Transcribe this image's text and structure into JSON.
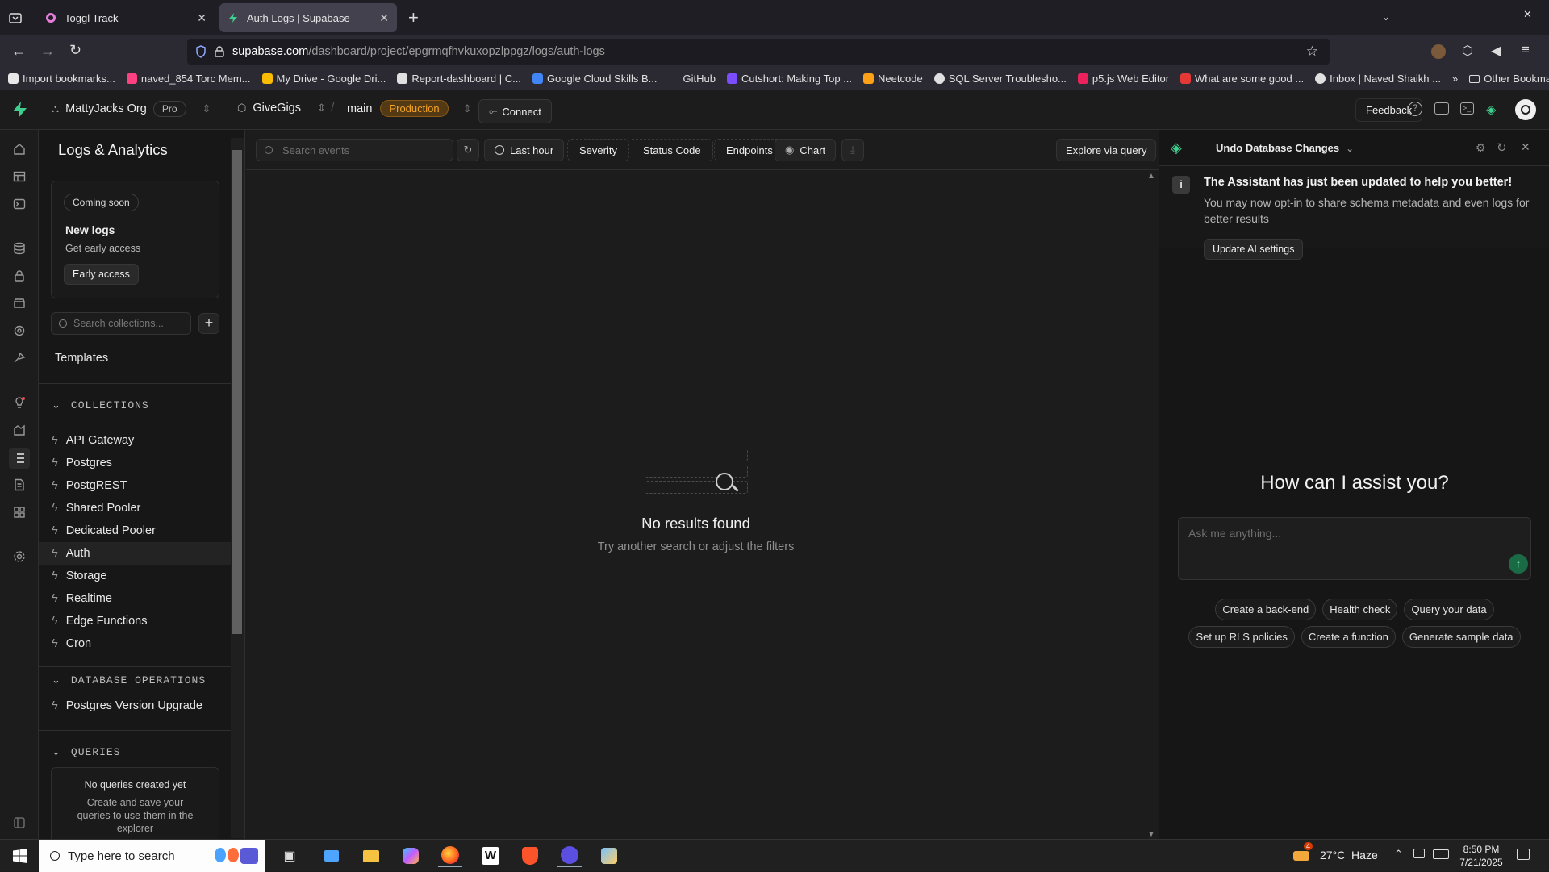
{
  "browser": {
    "tabs": [
      {
        "title": "Toggl Track",
        "active": false
      },
      {
        "title": "Auth Logs | Supabase",
        "active": true
      }
    ],
    "url": {
      "host": "supabase.com",
      "path": "/dashboard/project/epgrmqfhvkuxopzlppgz/logs/auth-logs"
    },
    "bookmarks": [
      {
        "label": "Import bookmarks...",
        "color": "#e8e8e8"
      },
      {
        "label": "naved_854 Torc Mem...",
        "color": "#ff4081"
      },
      {
        "label": "My Drive - Google Dri...",
        "color": "#fbbc04"
      },
      {
        "label": "Report-dashboard | C...",
        "color": "#e0e0e0"
      },
      {
        "label": "Google Cloud Skills B...",
        "color": "#4285f4"
      },
      {
        "label": "GitHub",
        "color": "#2b2a33"
      },
      {
        "label": "Cutshort: Making Top ...",
        "color": "#7c4dff"
      },
      {
        "label": "Neetcode",
        "color": "#ffa116"
      },
      {
        "label": "SQL Server Troublesho...",
        "color": "#e0e0e0"
      },
      {
        "label": "p5.js Web Editor",
        "color": "#ed225d"
      },
      {
        "label": "What are some good ...",
        "color": "#e53935"
      },
      {
        "label": "Inbox | Naved Shaikh ...",
        "color": "#e0e0e0"
      }
    ],
    "other_bookmarks": "Other Bookmarks"
  },
  "header": {
    "org": "MattyJacks Org",
    "plan": "Pro",
    "project": "GiveGigs",
    "branch": "main",
    "environment": "Production",
    "connect": "Connect",
    "feedback": "Feedback"
  },
  "sidebar": {
    "title": "Logs & Analytics",
    "promo": {
      "badge": "Coming soon",
      "title": "New logs",
      "subtitle": "Get early access",
      "button": "Early access"
    },
    "search_placeholder": "Search collections...",
    "templates": "Templates",
    "collections_header": "COLLECTIONS",
    "collections": [
      "API Gateway",
      "Postgres",
      "PostgREST",
      "Shared Pooler",
      "Dedicated Pooler",
      "Auth",
      "Storage",
      "Realtime",
      "Edge Functions",
      "Cron"
    ],
    "selected": "Auth",
    "db_ops_header": "DATABASE OPERATIONS",
    "db_ops": [
      "Postgres Version Upgrade"
    ],
    "queries_header": "QUERIES",
    "queries_empty_title": "No queries created yet",
    "queries_empty_text": "Create and save your queries to use them in the explorer"
  },
  "toolbar": {
    "search_placeholder": "Search events",
    "time_range": "Last hour",
    "severity": "Severity",
    "status_code": "Status Code",
    "endpoints": "Endpoints",
    "chart": "Chart",
    "explore": "Explore via query"
  },
  "empty_state": {
    "title": "No results found",
    "subtitle": "Try another search or adjust the filters"
  },
  "assistant": {
    "title": "Undo Database Changes",
    "notice_title": "The Assistant has just been updated to help you better!",
    "notice_text": "You may now opt-in to share schema metadata and even logs for better results",
    "notice_button": "Update AI settings",
    "heading": "How can I assist you?",
    "input_placeholder": "Ask me anything...",
    "suggestions_row1": [
      "Create a back-end",
      "Health check",
      "Query your data"
    ],
    "suggestions_row2": [
      "Set up RLS policies",
      "Create a function",
      "Generate sample data"
    ]
  },
  "taskbar": {
    "search_placeholder": "Type here to search",
    "weather": "27°C  Haze",
    "weather_badge": "4",
    "time": "8:50 PM",
    "date": "7/21/2025"
  },
  "colors": {
    "accent": "#3ecf8e",
    "production": "#f5a524",
    "background": "#1c1c1c"
  }
}
